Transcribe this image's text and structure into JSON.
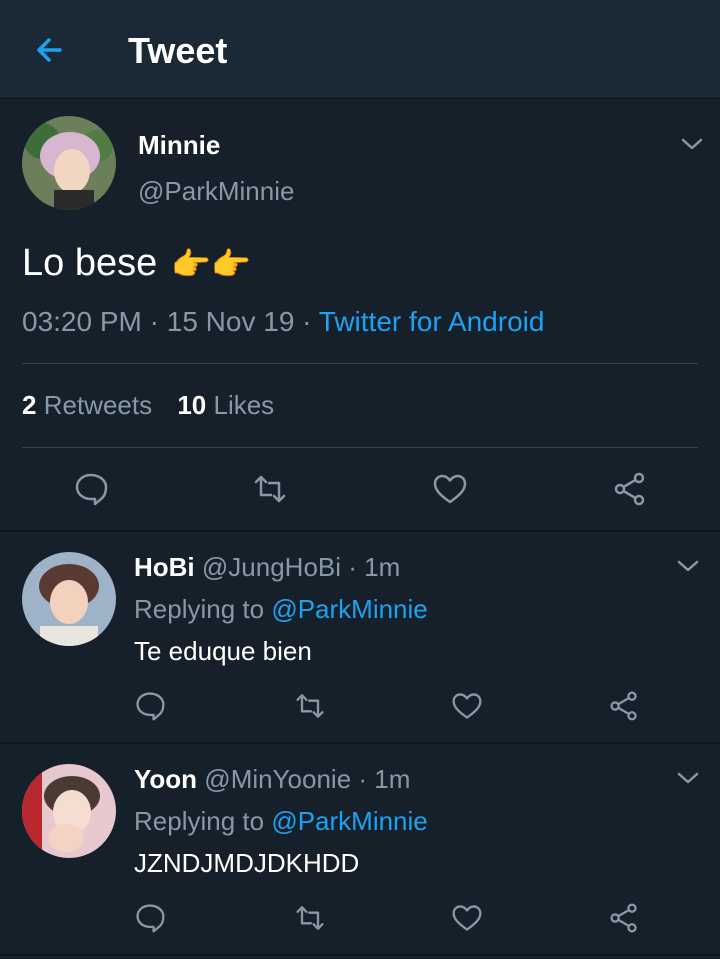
{
  "header": {
    "title": "Tweet"
  },
  "tweet": {
    "name": "Minnie",
    "handle": "@ParkMinnie",
    "text": "Lo bese",
    "emoji": "👉👉",
    "time": "03:20 PM",
    "date": "15 Nov 19",
    "source": "Twitter for Android",
    "retweets_count": "2",
    "retweets_label": "Retweets",
    "likes_count": "10",
    "likes_label": "Likes"
  },
  "replies": [
    {
      "name": "HoBi",
      "handle": "@JungHoBi",
      "time": "1m",
      "replying_label": "Replying to",
      "replying_to": "@ParkMinnie",
      "text": "Te eduque bien"
    },
    {
      "name": "Yoon",
      "handle": "@MinYoonie",
      "time": "1m",
      "replying_label": "Replying to",
      "replying_to": "@ParkMinnie",
      "text": "JZNDJMDJDKHDD"
    }
  ],
  "colors": {
    "background": "#15202b",
    "header": "#1b2836",
    "accent": "#1da1f2",
    "muted": "#8899a6"
  },
  "icons": [
    "back-arrow-icon",
    "chevron-down-icon",
    "reply-icon",
    "retweet-icon",
    "like-icon",
    "share-icon"
  ]
}
